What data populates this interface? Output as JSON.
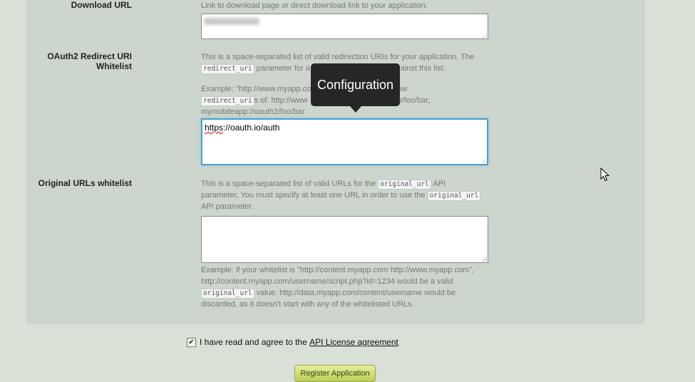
{
  "download": {
    "label": "Download URL",
    "help": "Link to download page or direct download link to your application."
  },
  "oauth": {
    "label_line1": "OAuth2 Redirect URI",
    "label_line2": "Whitelist",
    "help_a": "This is a space-separated list of valid redirection URIs for your application. The",
    "code": "redirect_uri",
    "help_b": "parameter for a",
    "help_c": "verified against this list.",
    "example_a": "Example: \"http://www.myapp.co",
    "example_b": "would allow",
    "example_c": "s of: http://www",
    "example_d": "yapp.com/foo/bar,",
    "example_e": "mymobileapp://oauth2/foo/bar",
    "value_scheme": "https",
    "value_rest": "://oauth.io/auth"
  },
  "tooltip": {
    "text": "Configuration"
  },
  "original": {
    "label": "Original URLs whitelist",
    "help_a": "This is a space-separated list of valid URLs for the",
    "code": "original_url",
    "help_b": "API",
    "help_c": "parameter. You must specify at least one URL in order to use the",
    "help_d": "API parameter.",
    "example_a": "Example: if your whitelist is \"http://content.myapp.com http://www.myapp.com\",",
    "example_b": "http://content.myapp.com/username/script.php?id=1234 would be a valid",
    "example_c": "value. http://data.myapp.com/content/username would be",
    "example_d": "discarded, as it doesn't start with any of the whitelisted URLs."
  },
  "agree": {
    "text": "I have read and agree to the",
    "link": "API License agreement",
    "checked": true
  },
  "submit": {
    "label": "Register Application"
  },
  "colors": {
    "panel": "#ccd6cc",
    "page": "#d9e0d6",
    "focus": "#4d9fd1",
    "button": "#c9d66a"
  }
}
